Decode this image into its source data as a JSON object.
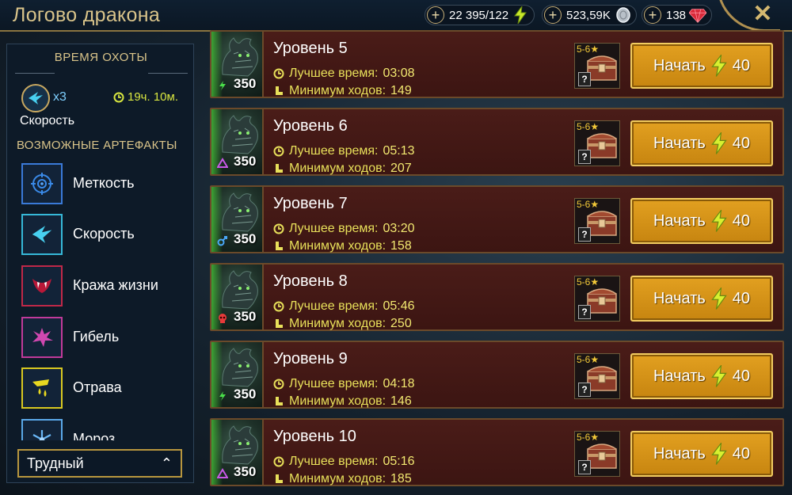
{
  "header": {
    "title": "Логово дракона",
    "resources": [
      {
        "value": "22 395/122",
        "icon": "energy-icon"
      },
      {
        "value": "523,59K",
        "icon": "silver-icon"
      },
      {
        "value": "138",
        "icon": "gem-icon"
      }
    ],
    "close_label": "✕"
  },
  "sidebar": {
    "hunt_title": "ВРЕМЯ ОХОТЫ",
    "boost": {
      "count": "x3",
      "timer": "19ч. 10м.",
      "label": "Скорость"
    },
    "artifacts_title": "ВОЗМОЖНЫЕ АРТЕФАКТЫ",
    "artifacts": [
      {
        "label": "Меткость",
        "icon": "accuracy-icon",
        "color": "#3a7ad8"
      },
      {
        "label": "Скорость",
        "icon": "speed-icon",
        "color": "#36b8d8"
      },
      {
        "label": "Кража жизни",
        "icon": "lifesteal-icon",
        "color": "#c02848"
      },
      {
        "label": "Гибель",
        "icon": "destroy-icon",
        "color": "#c03a9a"
      },
      {
        "label": "Отрава",
        "icon": "poison-icon",
        "color": "#d8c820"
      },
      {
        "label": "Мороз",
        "icon": "frost-icon",
        "color": "#5aa8e8"
      }
    ],
    "difficulty": "Трудный"
  },
  "levels": [
    {
      "name": "Уровень 5",
      "best_label": "Лучшее время:",
      "best_value": "03:08",
      "moves_label": "Минимум ходов:",
      "moves_value": "149",
      "power": "350",
      "affinity": "magic",
      "stars": "5-6",
      "start_label": "Начать",
      "cost": "40"
    },
    {
      "name": "Уровень 6",
      "best_label": "Лучшее время:",
      "best_value": "05:13",
      "moves_label": "Минимум ходов:",
      "moves_value": "207",
      "power": "350",
      "affinity": "void",
      "stars": "5-6",
      "start_label": "Начать",
      "cost": "40"
    },
    {
      "name": "Уровень 7",
      "best_label": "Лучшее время:",
      "best_value": "03:20",
      "moves_label": "Минимум ходов:",
      "moves_value": "158",
      "power": "350",
      "affinity": "force",
      "stars": "5-6",
      "start_label": "Начать",
      "cost": "40"
    },
    {
      "name": "Уровень 8",
      "best_label": "Лучшее время:",
      "best_value": "05:46",
      "moves_label": "Минимум ходов:",
      "moves_value": "250",
      "power": "350",
      "affinity": "skull",
      "stars": "5-6",
      "start_label": "Начать",
      "cost": "40"
    },
    {
      "name": "Уровень 9",
      "best_label": "Лучшее время:",
      "best_value": "04:18",
      "moves_label": "Минимум ходов:",
      "moves_value": "146",
      "power": "350",
      "affinity": "magic",
      "stars": "5-6",
      "start_label": "Начать",
      "cost": "40"
    },
    {
      "name": "Уровень 10",
      "best_label": "Лучшее время:",
      "best_value": "05:16",
      "moves_label": "Минимум ходов:",
      "moves_value": "185",
      "power": "350",
      "affinity": "void",
      "stars": "5-6",
      "start_label": "Начать",
      "cost": "40"
    }
  ]
}
